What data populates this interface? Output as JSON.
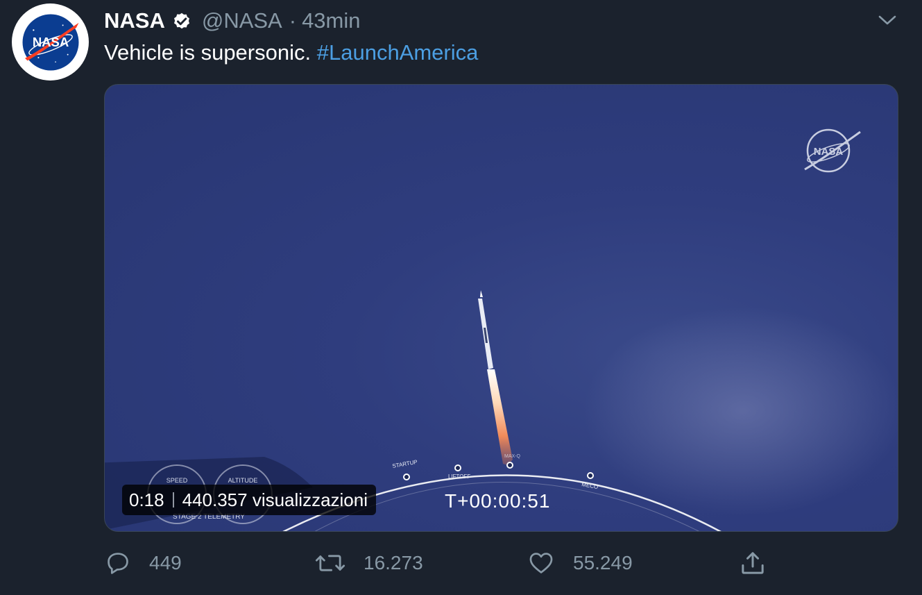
{
  "tweet": {
    "author": {
      "display_name": "NASA",
      "handle": "@NASA",
      "separator": "·",
      "time": "43min",
      "avatar_text": "NASA"
    },
    "text": "Vehicle is supersonic.",
    "hashtag": "#LaunchAmerica"
  },
  "media": {
    "watermark_text": "NASA",
    "countdown": "T+00:00:51",
    "duration": "0:18",
    "views": "440.357 visualizzazioni",
    "timeline_labels": [
      "STARTUP",
      "LIFTOFF",
      "MAX-Q",
      "MECO"
    ],
    "telemetry": {
      "speed_label": "SPEED",
      "altitude_label": "ALTITUDE",
      "stage_label": "STAGE 2 TELEMETRY"
    }
  },
  "actions": {
    "replies": "449",
    "retweets": "16.273",
    "likes": "55.249"
  },
  "colors": {
    "background": "#1b222d",
    "link": "#4c9fe3",
    "muted": "#8899a6",
    "sky": "#2f3d7e"
  },
  "icons": {
    "reply": "speech-bubble-icon",
    "retweet": "retweet-icon",
    "like": "heart-icon",
    "share": "share-icon",
    "caret": "chevron-down-icon",
    "verified": "verified-badge-icon"
  }
}
